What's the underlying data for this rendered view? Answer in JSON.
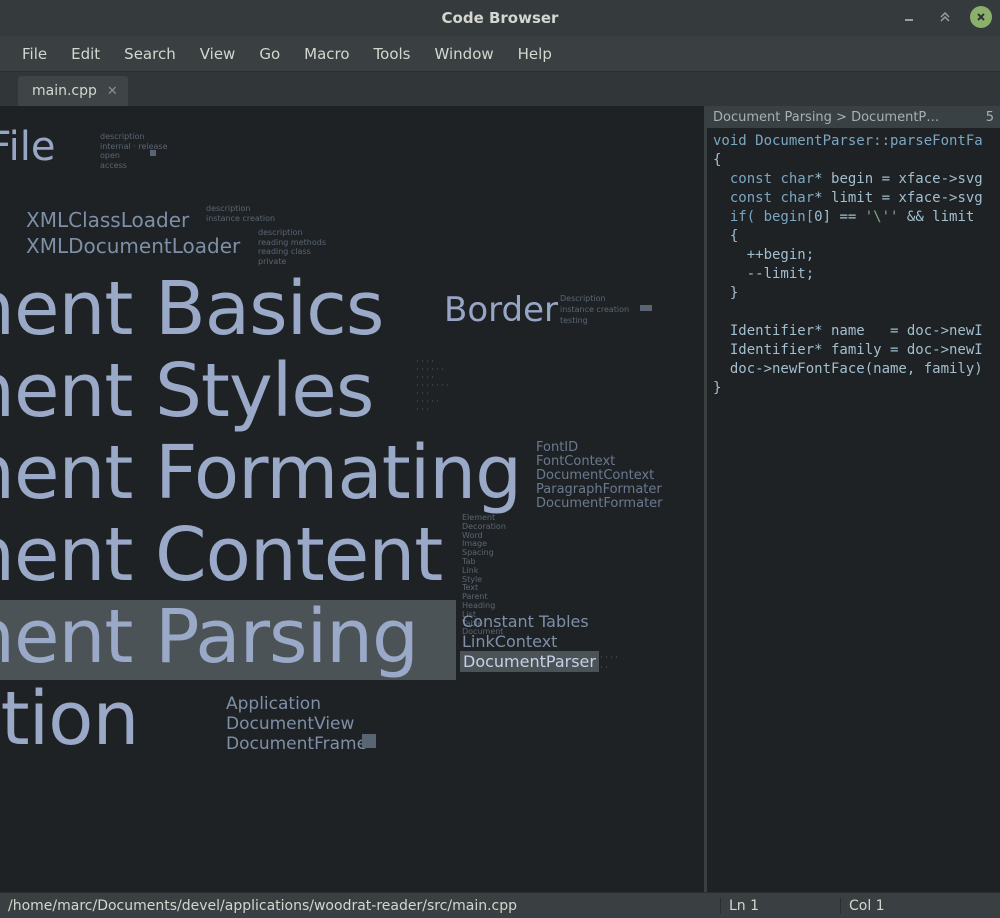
{
  "window": {
    "title": "Code Browser"
  },
  "menu": [
    "File",
    "Edit",
    "Search",
    "View",
    "Go",
    "Macro",
    "Tools",
    "Window",
    "Help"
  ],
  "tabs": [
    {
      "label": "main.cpp"
    }
  ],
  "overview": {
    "zipfile": "ipFile",
    "xml1": "XMLClassLoader",
    "xml2": "XMLDocumentLoader",
    "big1": "ument Basics",
    "border": "Border",
    "border_sub1": "Description",
    "border_sub2": "instance creation",
    "border_sub3": "testing",
    "big2": "ument Styles",
    "big3": "ument Formating",
    "fmt1": "FontID",
    "fmt2": "FontContext",
    "fmt3": "DocumentContext",
    "fmt4": "ParagraphFormater",
    "fmt5": "DocumentFormater",
    "big4": "ument Content",
    "big5": "ument Parsing",
    "prs1": "Constant Tables",
    "prs2": "LinkContext",
    "prs3": "DocumentParser",
    "big6": "ication",
    "app1": "Application",
    "app2": "DocumentView",
    "app3": "DocumentFrame"
  },
  "code_header": {
    "crumb": "Document Parsing  >  DocumentP…",
    "count": "5"
  },
  "code": {
    "l1": "void DocumentParser::parseFontFa",
    "l2": "{",
    "l3a": "  const ",
    "l3b": "char",
    "l3c": "* begin = xface->svg",
    "l4a": "  const ",
    "l4b": "char",
    "l4c": "* limit = xface->svg",
    "l5a": "  if( begin[",
    "l5n": "0",
    "l5b": "] == ",
    "l5s": "'\\''",
    "l5c": " && limit ",
    "l6": "  {",
    "l7": "    ++begin;",
    "l8": "    --limit;",
    "l9": "  }",
    "blank": "",
    "l10": "  Identifier* name   = doc->newI",
    "l11": "  Identifier* family = doc->newI",
    "l12": "  doc->newFontFace(name, family)",
    "l13": "}"
  },
  "status": {
    "path": "/home/marc/Documents/devel/applications/woodrat-reader/src/main.cpp",
    "ln": "Ln 1",
    "col": "Col 1"
  }
}
